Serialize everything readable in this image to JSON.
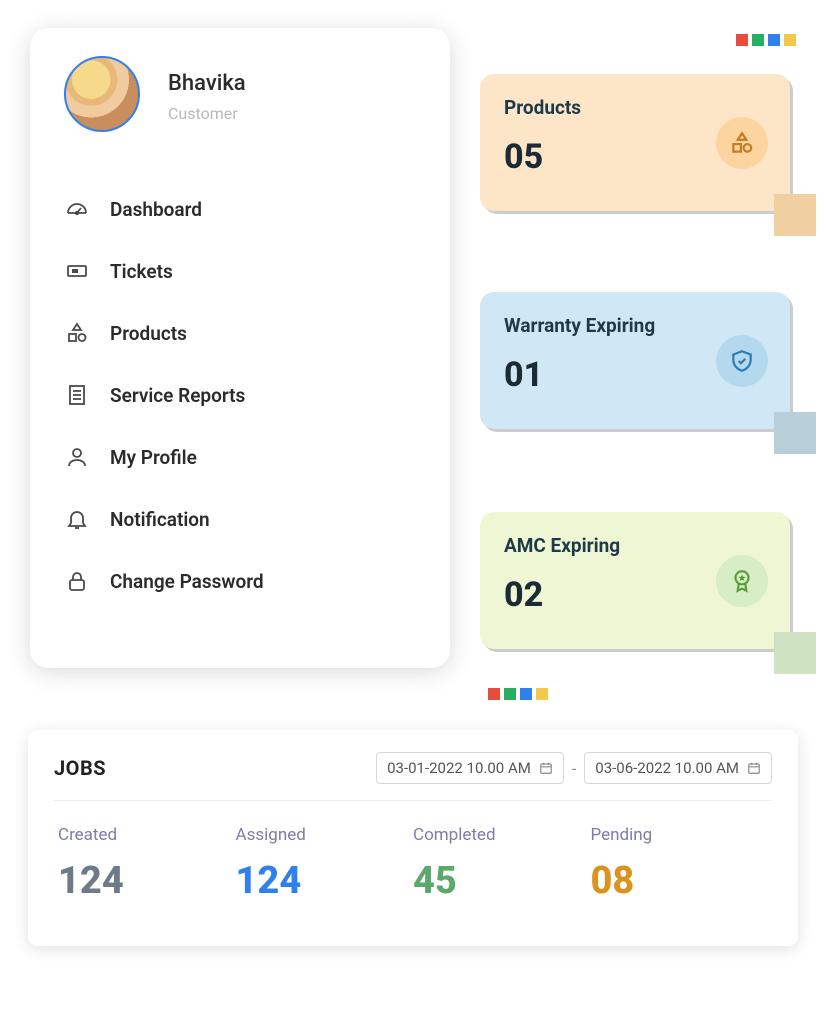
{
  "profile": {
    "name": "Bhavika",
    "role": "Customer"
  },
  "nav": {
    "dashboard": "Dashboard",
    "tickets": "Tickets",
    "products": "Products",
    "service_reports": "Service Reports",
    "my_profile": "My Profile",
    "notification": "Notification",
    "change_password": "Change Password"
  },
  "cards": {
    "products": {
      "title": "Products",
      "value": "05"
    },
    "warranty": {
      "title": "Warranty Expiring",
      "value": "01"
    },
    "amc": {
      "title": "AMC Expiring",
      "value": "02"
    }
  },
  "jobs": {
    "title": "JOBS",
    "date_from": "03-01-2022 10.00 AM",
    "date_to": "03-06-2022 10.00 AM",
    "separator": "-",
    "stats": {
      "created": {
        "label": "Created",
        "value": "124"
      },
      "assigned": {
        "label": "Assigned",
        "value": "124"
      },
      "completed": {
        "label": "Completed",
        "value": "45"
      },
      "pending": {
        "label": "Pending",
        "value": "08"
      }
    }
  }
}
